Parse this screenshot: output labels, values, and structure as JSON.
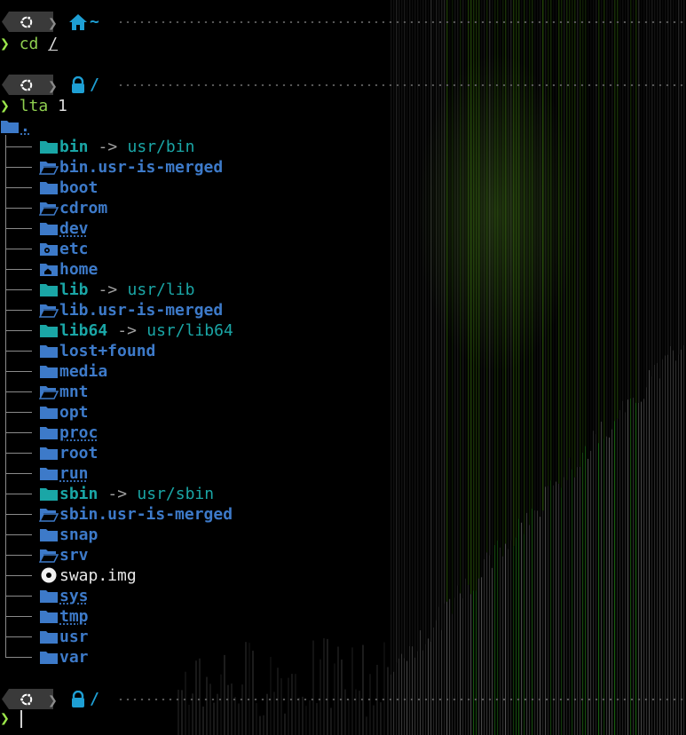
{
  "prompts": [
    {
      "path_icon": "home-icon",
      "path_text": "~",
      "command": "cd",
      "argument": "/"
    },
    {
      "path_icon": "lock-icon",
      "path_text": "/",
      "command": "lta",
      "argument": "1"
    },
    {
      "path_icon": "lock-icon",
      "path_text": "/",
      "command": "",
      "argument": ""
    }
  ],
  "prompt_symbol": "❯",
  "tree_root": ".",
  "tree": [
    {
      "name": "bin",
      "type": "link",
      "icon": "folder-icon",
      "arrow": "->",
      "target": "usr/bin"
    },
    {
      "name": "bin.usr-is-merged",
      "type": "dir",
      "icon": "folder-open-icon"
    },
    {
      "name": "boot",
      "type": "dir",
      "icon": "folder-icon"
    },
    {
      "name": "cdrom",
      "type": "dir",
      "icon": "folder-open-icon"
    },
    {
      "name": "dev",
      "type": "dir-dotted",
      "icon": "folder-icon"
    },
    {
      "name": "etc",
      "type": "dir",
      "icon": "folder-gear-icon"
    },
    {
      "name": "home",
      "type": "dir",
      "icon": "folder-home-icon"
    },
    {
      "name": "lib",
      "type": "link",
      "icon": "folder-icon",
      "arrow": "->",
      "target": "usr/lib"
    },
    {
      "name": "lib.usr-is-merged",
      "type": "dir",
      "icon": "folder-open-icon"
    },
    {
      "name": "lib64",
      "type": "link",
      "icon": "folder-icon",
      "arrow": "->",
      "target": "usr/lib64"
    },
    {
      "name": "lost+found",
      "type": "dir",
      "icon": "folder-icon"
    },
    {
      "name": "media",
      "type": "dir",
      "icon": "folder-icon"
    },
    {
      "name": "mnt",
      "type": "dir",
      "icon": "folder-open-icon"
    },
    {
      "name": "opt",
      "type": "dir",
      "icon": "folder-icon"
    },
    {
      "name": "proc",
      "type": "dir-dotted",
      "icon": "folder-icon"
    },
    {
      "name": "root",
      "type": "dir",
      "icon": "folder-icon"
    },
    {
      "name": "run",
      "type": "dir-dotted",
      "icon": "folder-icon"
    },
    {
      "name": "sbin",
      "type": "link",
      "icon": "folder-icon",
      "arrow": "->",
      "target": "usr/sbin"
    },
    {
      "name": "sbin.usr-is-merged",
      "type": "dir",
      "icon": "folder-open-icon"
    },
    {
      "name": "snap",
      "type": "dir",
      "icon": "folder-icon"
    },
    {
      "name": "srv",
      "type": "dir",
      "icon": "folder-open-icon"
    },
    {
      "name": "swap.img",
      "type": "file",
      "icon": "disk-icon"
    },
    {
      "name": "sys",
      "type": "dir-dotted",
      "icon": "folder-icon"
    },
    {
      "name": "tmp",
      "type": "dir-dotted",
      "icon": "folder-icon"
    },
    {
      "name": "usr",
      "type": "dir",
      "icon": "folder-icon"
    },
    {
      "name": "var",
      "type": "dir",
      "icon": "folder-icon"
    }
  ],
  "colors": {
    "background": "#000000",
    "dir": "#3d7ac9",
    "link": "#1aa6a6",
    "prompt": "#9be64a",
    "path": "#1e9fd4",
    "bar": "#3a3a3a"
  }
}
